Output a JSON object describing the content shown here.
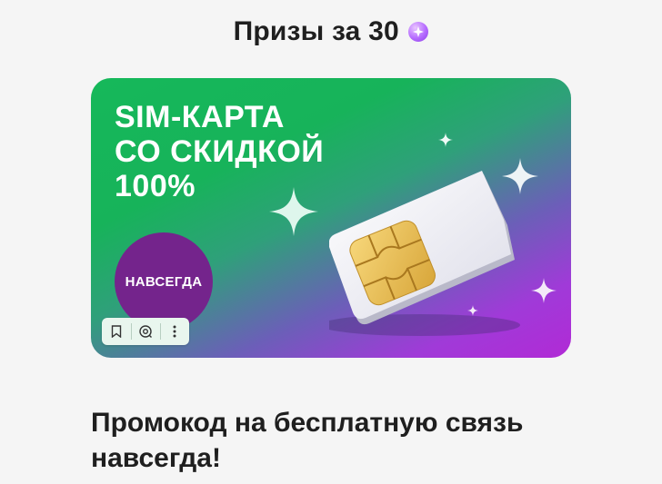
{
  "header": {
    "title": "Призы за 30",
    "coin_icon": "crystal-coin-icon",
    "coin_color": "#b56bff"
  },
  "banner": {
    "headline_lines": [
      "SIM-КАРТА",
      "СО СКИДКОЙ",
      "100%"
    ],
    "badge_text": "НАВСЕГДА",
    "badge_color": "#74248c",
    "gradient_colors": [
      "#16b85a",
      "#b12ad6"
    ],
    "image": "sim-card-icon"
  },
  "toolbar": {
    "items": [
      "bookmark-icon",
      "lens-search-icon",
      "more-vertical-icon"
    ]
  },
  "caption": {
    "text": "Промокод на бесплатную связь навсегда!"
  }
}
